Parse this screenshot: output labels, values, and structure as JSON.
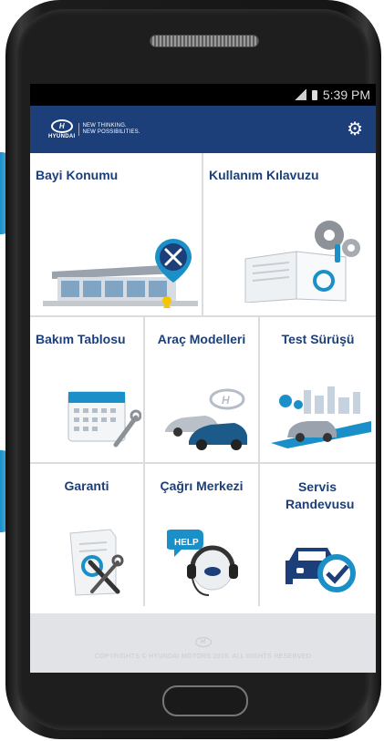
{
  "status_bar": {
    "time": "5:39 PM"
  },
  "header": {
    "brand_word": "HYUNDAI",
    "slogan_line1": "NEW THINKING.",
    "slogan_line2": "NEW POSSIBILITIES.",
    "settings_icon": "gear-icon"
  },
  "menu": {
    "dealer_location": "Bayi Konumu",
    "user_manual": "Kullanım Kılavuzu",
    "maintenance_table": "Bakım Tablosu",
    "car_models": "Araç Modelleri",
    "test_drive": "Test Sürüşü",
    "warranty": "Garanti",
    "call_center": "Çağrı Merkezi",
    "service_appointment": "Servis Randevusu"
  },
  "illustrations": {
    "help_badge": "HELP"
  },
  "footer": {
    "copyright": "COPYRIGHTS © HYUNDAI MOTORS 2016. ALL RIGHTS RESERVED"
  },
  "colors": {
    "header_bg": "#1c3f7a",
    "label": "#1c3f7a",
    "accent_blue": "#1b8fc8"
  }
}
